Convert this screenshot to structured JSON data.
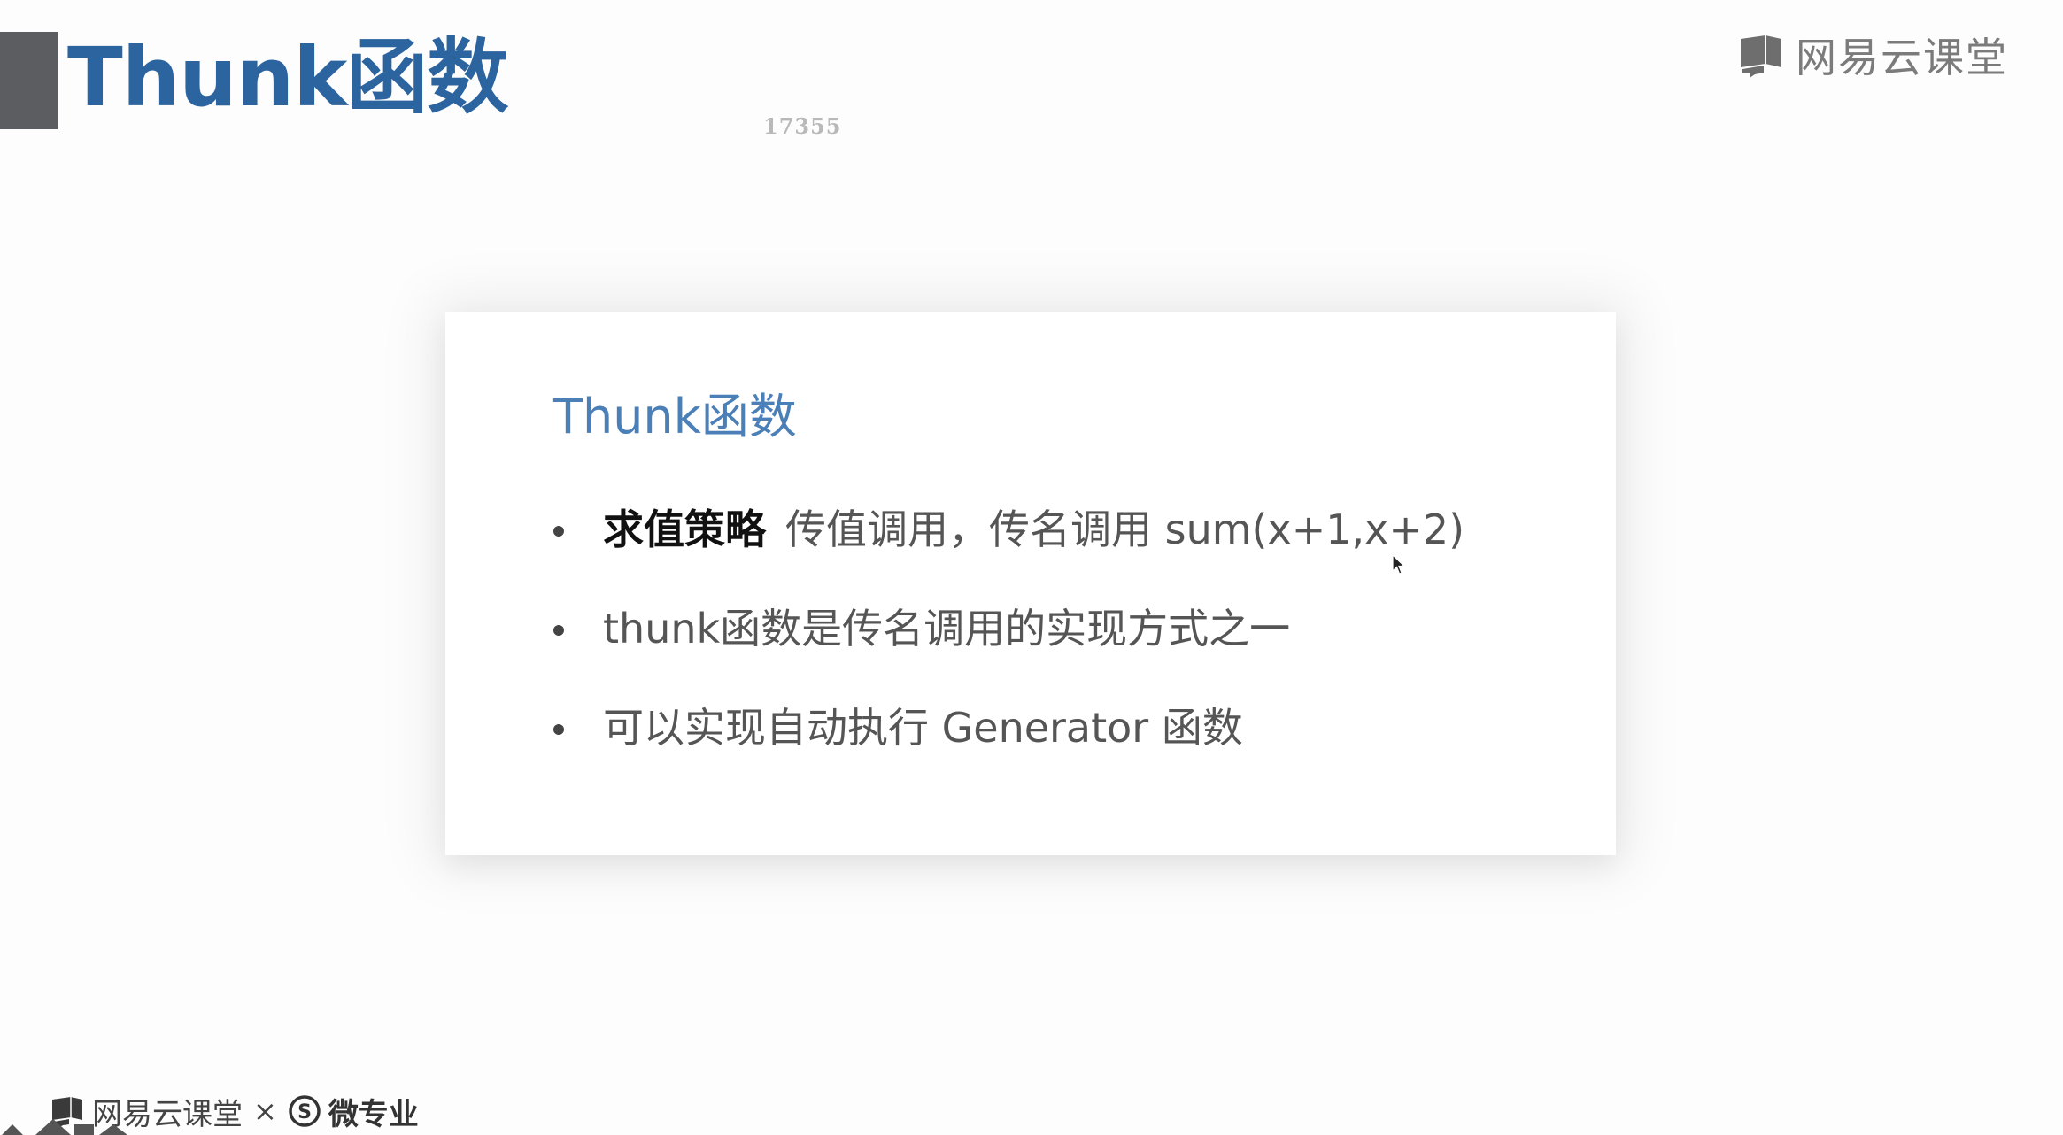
{
  "slide": {
    "title": "Thunk函数",
    "watermark_number": "17355",
    "brand": "网易云课堂",
    "card": {
      "heading": "Thunk函数",
      "bullets": [
        {
          "strong": "求值策略",
          "text": "传值调用，传名调用 sum(x+1,x+2)"
        },
        {
          "strong": "",
          "text": "thunk函数是传名调用的实现方式之一"
        },
        {
          "strong": "",
          "text": "可以实现自动执行 Generator 函数"
        }
      ]
    },
    "footer": {
      "brand": "网易云课堂",
      "separator": "×",
      "partner": "微专业"
    }
  },
  "colors": {
    "title": "#2c64a0",
    "card_heading": "#4a7fb7",
    "title_bar": "#5b5d61",
    "brand_gray": "#7b7b7b"
  },
  "icons": {
    "brand_logo": "book-icon",
    "footer_logo": "book-icon",
    "partner_logo": "s-circle-icon",
    "pointer": "mouse-cursor-icon",
    "nav": "slide-nav-arrows-icon"
  }
}
